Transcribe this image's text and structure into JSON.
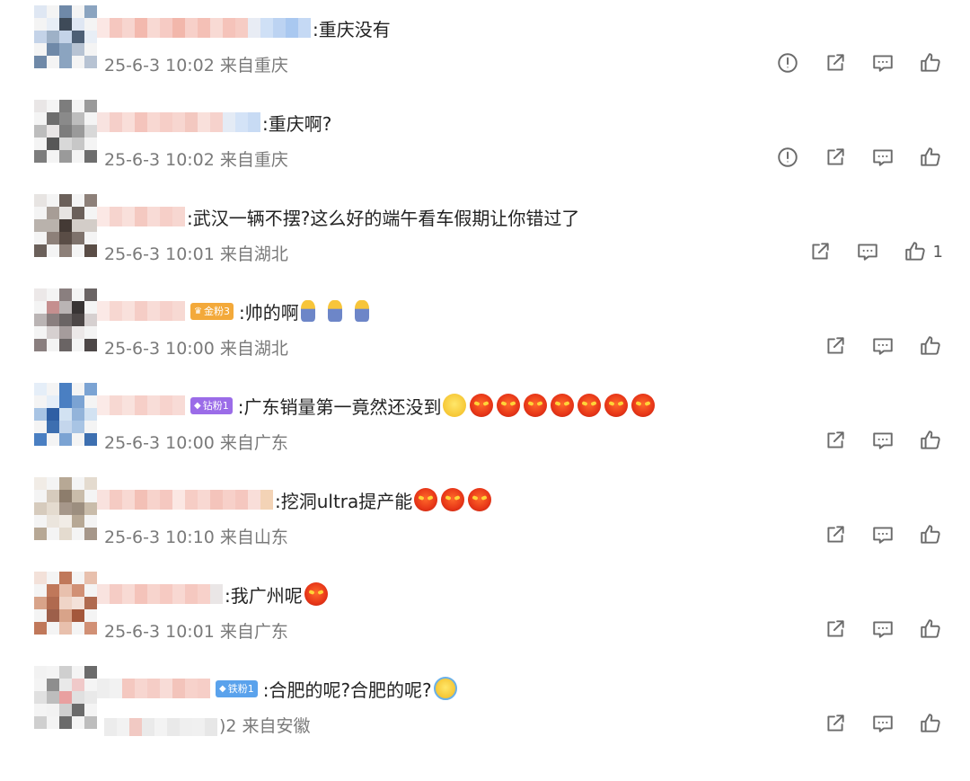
{
  "colors": {
    "badge_gold": "#f3a93a",
    "badge_purple": "#9b6ce8",
    "badge_blue": "#5aa2ec",
    "meta_gray": "#7a7a7a",
    "icon_gray": "#6b6b6b"
  },
  "comments": [
    {
      "content": ":重庆没有",
      "meta": "25-6-3 10:02 来自重庆",
      "report_icon": "report-icon",
      "like_count": ""
    },
    {
      "content": ":重庆啊?",
      "meta": "25-6-3 10:02 来自重庆",
      "report_icon": "report-icon",
      "like_count": ""
    },
    {
      "content": ":武汉一辆不摆?这么好的端午看车假期让你错过了",
      "meta": "25-6-3 10:01 来自湖北",
      "like_count": "1"
    },
    {
      "badge": "金粉3",
      "content": ":帅的啊",
      "emojis": [
        "person-emoji",
        "person-emoji",
        "person-emoji"
      ],
      "meta": "25-6-3 10:00 来自湖北",
      "like_count": ""
    },
    {
      "badge": "钻粉1",
      "content": ":广东销量第一竟然还没到",
      "emojis": [
        "thinking-emoji",
        "angry-emoji",
        "angry-emoji",
        "angry-emoji",
        "angry-emoji",
        "angry-emoji",
        "angry-emoji",
        "angry-emoji"
      ],
      "meta": "25-6-3 10:00 来自广东",
      "like_count": ""
    },
    {
      "content": ":挖洞ultra提产能",
      "emojis": [
        "angry-emoji",
        "angry-emoji",
        "angry-emoji"
      ],
      "meta": "25-6-3 10:10 来自山东",
      "like_count": ""
    },
    {
      "content": ":我广州呢",
      "emojis": [
        "angry-emoji"
      ],
      "meta": "25-6-3 10:01 来自广东",
      "like_count": ""
    },
    {
      "badge": "铁粉1",
      "content": ":合肥的呢?合肥的呢?",
      "emojis": [
        "laughing-emoji"
      ],
      "meta": ")2 来自安徽",
      "like_count": ""
    }
  ]
}
